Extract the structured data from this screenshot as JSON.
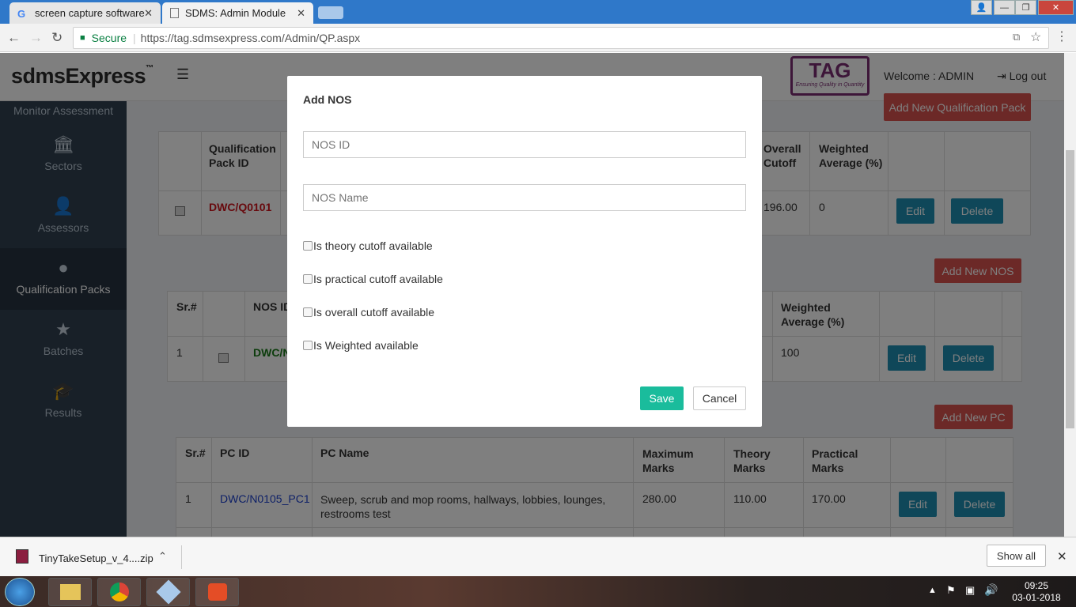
{
  "browser": {
    "tabs": [
      {
        "title": "screen capture software",
        "active": false
      },
      {
        "title": "SDMS: Admin Module",
        "active": true
      }
    ],
    "secure_label": "Secure",
    "url": "https://tag.sdmsexpress.com/Admin/QP.aspx"
  },
  "header": {
    "logo": "sdmsExpress",
    "logo_tm": "™",
    "tag_logo": "TAG",
    "tag_tagline": "Ensuring Quality in Quantity",
    "welcome": "Welcome : ADMIN",
    "logout": "Log out"
  },
  "sidebar": {
    "items": [
      {
        "label": "Monitor Assessment",
        "icon": "monitor-icon"
      },
      {
        "label": "Sectors",
        "icon": "bank-icon"
      },
      {
        "label": "Assessors",
        "icon": "user-icon"
      },
      {
        "label": "Qualification Packs",
        "icon": "globe-icon",
        "active": true
      },
      {
        "label": "Batches",
        "icon": "star-icon"
      },
      {
        "label": "Results",
        "icon": "graduation-cap-icon"
      }
    ]
  },
  "qp": {
    "add_button": "Add New Qualification Pack",
    "headers": [
      "Qualification Pack ID",
      "Overall Cutoff",
      "Weighted Average (%)"
    ],
    "row": {
      "id": "DWC/Q0101",
      "overall_cutoff": "196.00",
      "weighted": "0"
    },
    "edit": "Edit",
    "delete": "Delete"
  },
  "nos": {
    "add_button": "Add New NOS",
    "headers": [
      "Sr.#",
      "NOS ID",
      "Weighted Average (%)"
    ],
    "row": {
      "sr": "1",
      "id": "DWC/N",
      "weighted": "100"
    },
    "edit": "Edit",
    "delete": "Delete"
  },
  "pc": {
    "add_button": "Add New PC",
    "headers": [
      "Sr.#",
      "PC ID",
      "PC Name",
      "Maximum Marks",
      "Theory Marks",
      "Practical Marks"
    ],
    "row": {
      "sr": "1",
      "id": "DWC/N0105_PC1",
      "name": "Sweep, scrub and mop rooms, hallways, lobbies, lounges, restrooms test",
      "max": "280.00",
      "theory": "110.00",
      "practical": "170.00"
    },
    "edit": "Edit",
    "delete": "Delete"
  },
  "modal": {
    "title": "Add NOS",
    "nos_id_placeholder": "NOS ID",
    "nos_name_placeholder": "NOS Name",
    "checkboxes": [
      "Is theory cutoff available",
      "Is practical cutoff available",
      "Is overall cutoff available",
      "Is Weighted available"
    ],
    "save": "Save",
    "cancel": "Cancel"
  },
  "downloads": {
    "file": "TinyTakeSetup_v_4....zip",
    "show_all": "Show all"
  },
  "taskbar": {
    "time": "09:25",
    "date": "03-01-2018"
  }
}
